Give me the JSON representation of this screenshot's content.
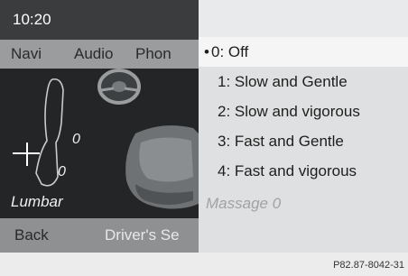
{
  "status": {
    "time": "10:20"
  },
  "menu_bar": {
    "items": [
      "Navi",
      "Audio",
      "Phon"
    ]
  },
  "seat": {
    "lumbar_label": "Lumbar",
    "upper_value": "0",
    "lower_value": "0"
  },
  "bottom_bar": {
    "back": "Back",
    "section": "Driver's Se"
  },
  "massage_menu": {
    "bullet": "•",
    "items": [
      {
        "label": "0: Off",
        "selected": true
      },
      {
        "label": "1: Slow and Gentle",
        "selected": false
      },
      {
        "label": "2: Slow and vigorous",
        "selected": false
      },
      {
        "label": "3: Fast and Gentle",
        "selected": false
      },
      {
        "label": "4: Fast and vigorous",
        "selected": false
      }
    ],
    "status_text": "Massage  0"
  },
  "caption": "P82.87-8042-31",
  "colors": {
    "left_panel": "#2f3133",
    "menu_bar": "#9a9c9e",
    "right_panel": "#dfe0e1"
  }
}
